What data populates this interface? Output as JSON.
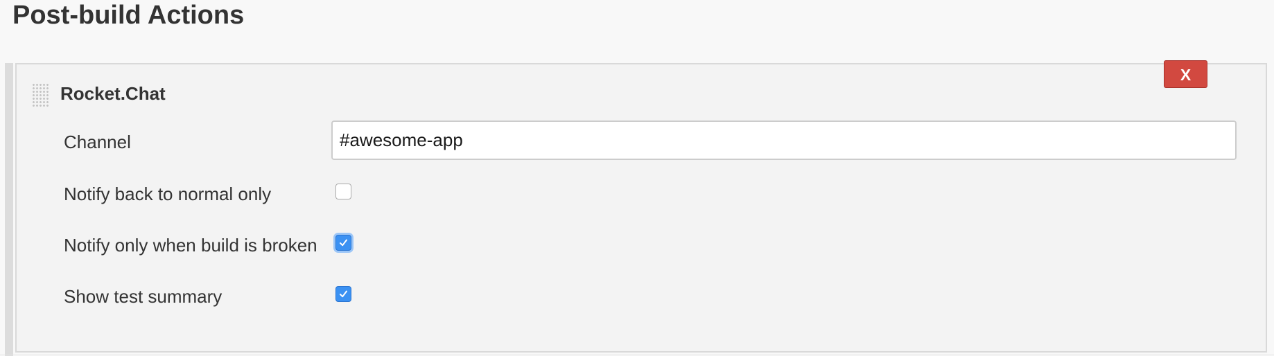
{
  "section": {
    "title": "Post-build Actions"
  },
  "panel": {
    "title": "Rocket.Chat",
    "delete_label": "X",
    "drag_handle_icon": "drag-handle-icon",
    "accent_colors": {
      "delete_button": "#d24940",
      "checkbox_checked": "#3b91f2"
    }
  },
  "fields": {
    "channel": {
      "label": "Channel",
      "value": "#awesome-app"
    },
    "notify_back_to_normal": {
      "label": "Notify back to normal only",
      "checked": false
    },
    "notify_only_broken": {
      "label": "Notify only when build is broken",
      "checked": true,
      "focused": true
    },
    "show_test_summary": {
      "label": "Show test summary",
      "checked": true
    }
  }
}
